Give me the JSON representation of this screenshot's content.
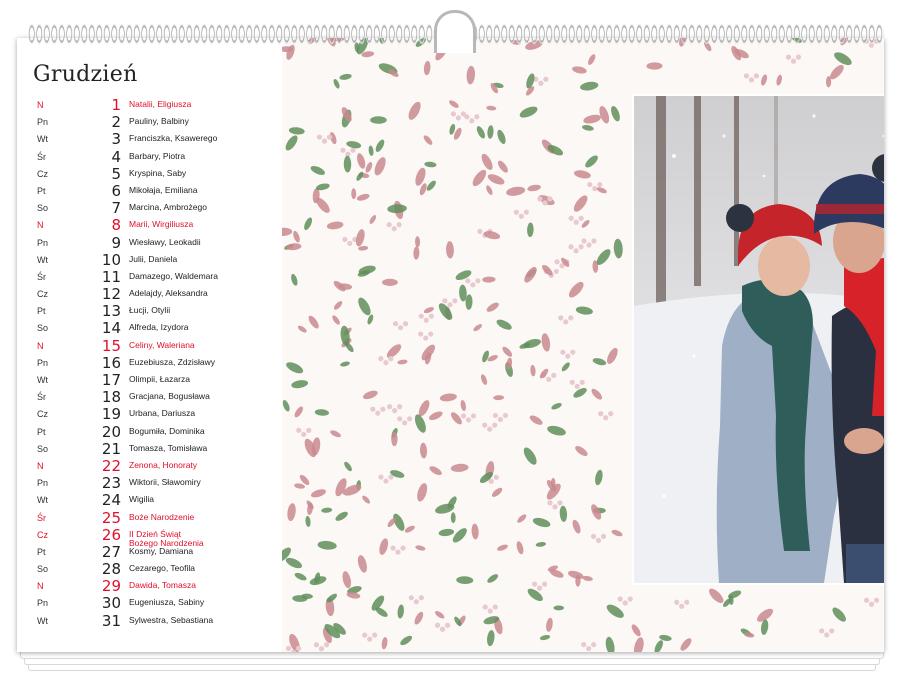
{
  "calendar": {
    "month": "Grudzień",
    "days": [
      {
        "wd": "N",
        "num": "1",
        "names": "Natalii, Eligiusza",
        "holiday": true
      },
      {
        "wd": "Pn",
        "num": "2",
        "names": "Pauliny, Balbiny",
        "holiday": false
      },
      {
        "wd": "Wt",
        "num": "3",
        "names": "Franciszka, Ksawerego",
        "holiday": false
      },
      {
        "wd": "Śr",
        "num": "4",
        "names": "Barbary, Piotra",
        "holiday": false
      },
      {
        "wd": "Cz",
        "num": "5",
        "names": "Kryspina, Saby",
        "holiday": false
      },
      {
        "wd": "Pt",
        "num": "6",
        "names": "Mikołaja, Emiliana",
        "holiday": false
      },
      {
        "wd": "So",
        "num": "7",
        "names": "Marcina, Ambrożego",
        "holiday": false
      },
      {
        "wd": "N",
        "num": "8",
        "names": "Marii, Wirgiliusza",
        "holiday": true
      },
      {
        "wd": "Pn",
        "num": "9",
        "names": "Wiesławy, Leokadii",
        "holiday": false
      },
      {
        "wd": "Wt",
        "num": "10",
        "names": "Julii, Daniela",
        "holiday": false
      },
      {
        "wd": "Śr",
        "num": "11",
        "names": "Damazego, Waldemara",
        "holiday": false
      },
      {
        "wd": "Cz",
        "num": "12",
        "names": "Adelajdy, Aleksandra",
        "holiday": false
      },
      {
        "wd": "Pt",
        "num": "13",
        "names": "Łucji, Otylii",
        "holiday": false
      },
      {
        "wd": "So",
        "num": "14",
        "names": "Alfreda, Izydora",
        "holiday": false
      },
      {
        "wd": "N",
        "num": "15",
        "names": "Celiny, Waleriana",
        "holiday": true
      },
      {
        "wd": "Pn",
        "num": "16",
        "names": "Euzebiusza, Zdzisławy",
        "holiday": false
      },
      {
        "wd": "Wt",
        "num": "17",
        "names": "Olimpii, Łazarza",
        "holiday": false
      },
      {
        "wd": "Śr",
        "num": "18",
        "names": "Gracjana, Bogusława",
        "holiday": false
      },
      {
        "wd": "Cz",
        "num": "19",
        "names": "Urbana, Dariusza",
        "holiday": false
      },
      {
        "wd": "Pt",
        "num": "20",
        "names": "Bogumiła, Dominika",
        "holiday": false
      },
      {
        "wd": "So",
        "num": "21",
        "names": "Tomasza, Tomisława",
        "holiday": false
      },
      {
        "wd": "N",
        "num": "22",
        "names": "Zenona, Honoraty",
        "holiday": true
      },
      {
        "wd": "Pn",
        "num": "23",
        "names": "Wiktorii, Sławomiry",
        "holiday": false
      },
      {
        "wd": "Wt",
        "num": "24",
        "names": "Wigilia",
        "holiday": false
      },
      {
        "wd": "Śr",
        "num": "25",
        "names": "Boże Narodzenie",
        "holiday": true
      },
      {
        "wd": "Cz",
        "num": "26",
        "names": "II Dzień Świąt\nBożego Narodzenia",
        "holiday": true
      },
      {
        "wd": "Pt",
        "num": "27",
        "names": "Kosmy, Damiana",
        "holiday": false
      },
      {
        "wd": "So",
        "num": "28",
        "names": "Cezarego, Teofila",
        "holiday": false
      },
      {
        "wd": "N",
        "num": "29",
        "names": "Dawida, Tomasza",
        "holiday": true
      },
      {
        "wd": "Pn",
        "num": "30",
        "names": "Eugeniusza, Sabiny",
        "holiday": false
      },
      {
        "wd": "Wt",
        "num": "31",
        "names": "Sylwestra, Sebastiana",
        "holiday": false
      }
    ]
  },
  "colors": {
    "holiday": "#e0102a",
    "leaf_pink": "#c98a8e",
    "leaf_green": "#5f8f5a",
    "berry": "#e9c9d0"
  },
  "photo": {
    "subject": "photo-couple-in-snow"
  }
}
